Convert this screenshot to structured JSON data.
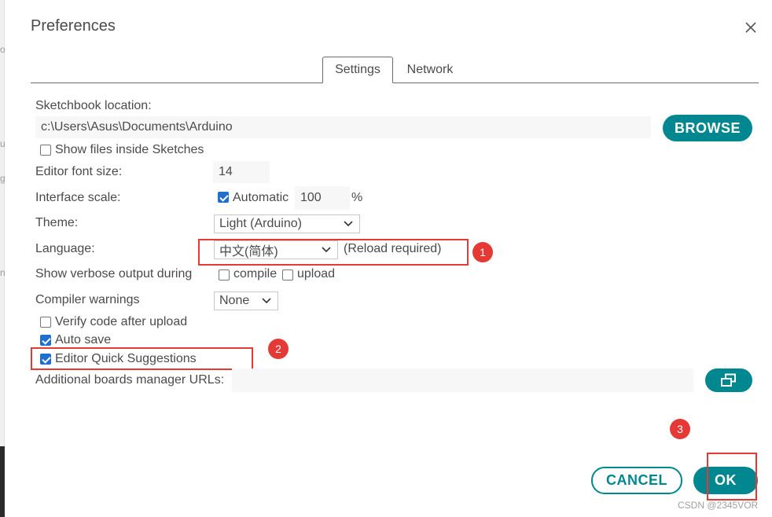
{
  "dialog": {
    "title": "Preferences"
  },
  "tabs": [
    {
      "label": "Settings",
      "active": true
    },
    {
      "label": "Network",
      "active": false
    }
  ],
  "settings": {
    "sketchbook_label": "Sketchbook location:",
    "sketchbook_value": "c:\\Users\\Asus\\Documents\\Arduino",
    "browse_label": "BROWSE",
    "show_files_label": "Show files inside Sketches",
    "show_files_checked": false,
    "font_size_label": "Editor font size:",
    "font_size_value": "14",
    "scale_label": "Interface scale:",
    "scale_auto_label": "Automatic",
    "scale_auto_checked": true,
    "scale_value": "100",
    "scale_unit": "%",
    "theme_label": "Theme:",
    "theme_value": "Light (Arduino)",
    "language_label": "Language:",
    "language_value": "中文(简体)",
    "language_note": "(Reload required)",
    "verbose_label": "Show verbose output during",
    "compile_label": "compile",
    "compile_checked": false,
    "upload_label": "upload",
    "upload_checked": false,
    "warnings_label": "Compiler warnings",
    "warnings_value": "None",
    "verify_label": "Verify code after upload",
    "verify_checked": false,
    "autosave_label": "Auto save",
    "autosave_checked": true,
    "quick_suggest_label": "Editor Quick Suggestions",
    "quick_suggest_checked": true,
    "boards_label": "Additional boards manager URLs:",
    "boards_value": ""
  },
  "footer": {
    "cancel_label": "CANCEL",
    "ok_label": "OK"
  },
  "annotations": {
    "badges": [
      "1",
      "2",
      "3"
    ],
    "color": "#e53935"
  },
  "watermark": "CSDN @2345VOR",
  "colors": {
    "accent": "#00878f",
    "checkbox": "#1f6fd1",
    "text": "#4b4b4b"
  },
  "icons": {
    "close": "close-icon",
    "chevron": "chevron-down-icon",
    "boards_edit": "open-window-icon"
  }
}
